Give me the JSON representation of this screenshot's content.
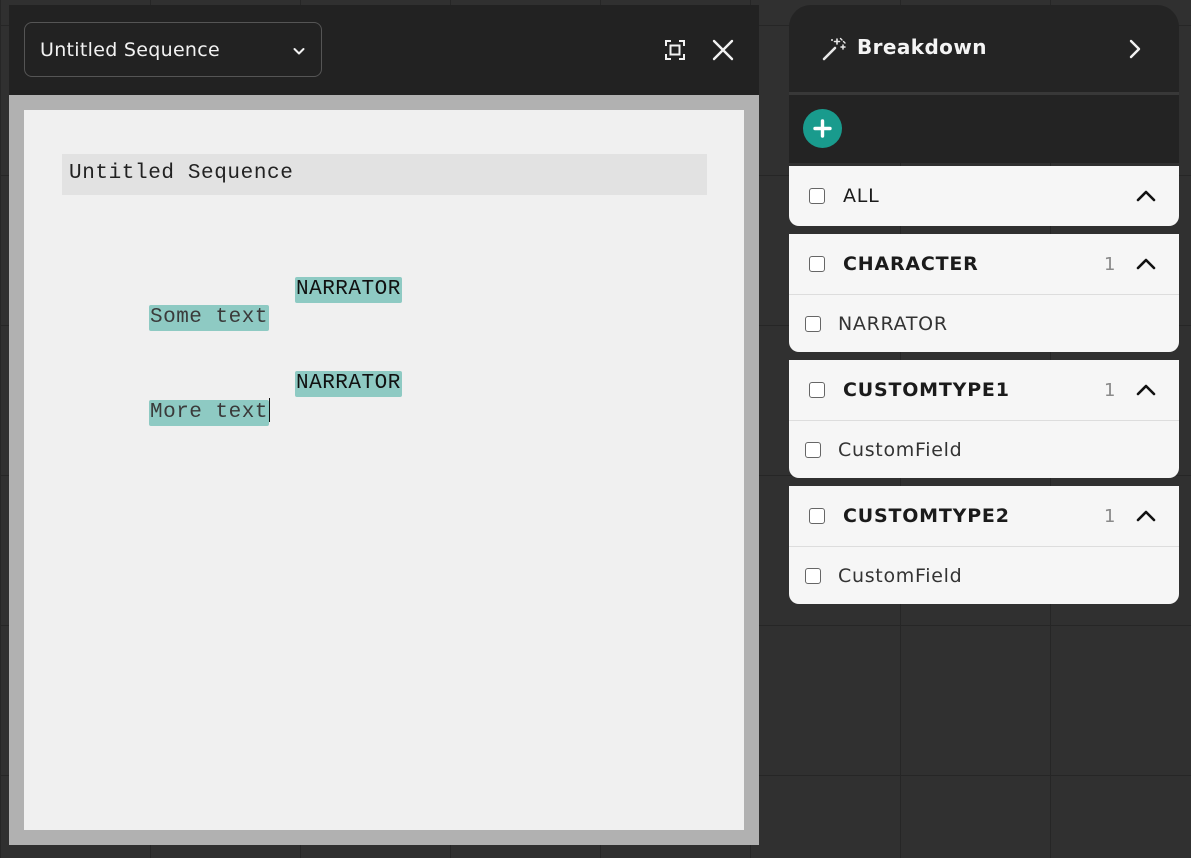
{
  "editor": {
    "sequence_select": {
      "label": "Untitled Sequence"
    },
    "document": {
      "title": "Untitled Sequence",
      "blocks": [
        {
          "character": "NARRATOR",
          "dialogue": "Some text"
        },
        {
          "character": "NARRATOR",
          "dialogue": "More text"
        }
      ]
    }
  },
  "breakdown": {
    "title": "Breakdown",
    "groups": [
      {
        "name": "ALL",
        "count": "",
        "items": []
      },
      {
        "name": "CHARACTER",
        "count": "1",
        "items": [
          "NARRATOR"
        ]
      },
      {
        "name": "CUSTOMTYPE1",
        "count": "1",
        "items": [
          "CustomField"
        ]
      },
      {
        "name": "CUSTOMTYPE2",
        "count": "1",
        "items": [
          "CustomField"
        ]
      }
    ]
  },
  "colors": {
    "accent": "#199b8d",
    "highlight": "#8ecac3"
  }
}
